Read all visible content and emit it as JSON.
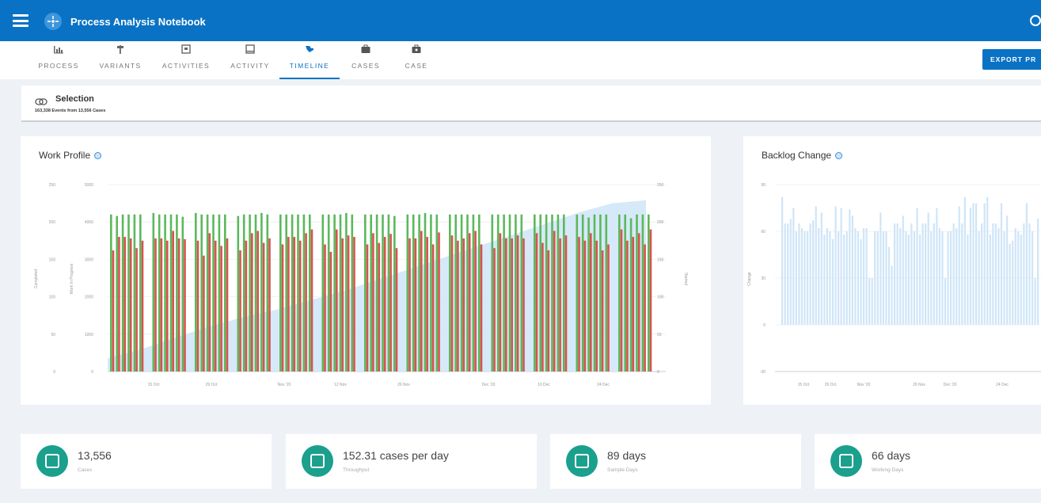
{
  "app": {
    "title": "Process Analysis Notebook"
  },
  "tabs": [
    {
      "label": "PROCESS",
      "icon": "bar-chart-icon"
    },
    {
      "label": "VARIANTS",
      "icon": "signpost-icon"
    },
    {
      "label": "ACTIVITIES",
      "icon": "activities-icon"
    },
    {
      "label": "ACTIVITY",
      "icon": "inbox-icon"
    },
    {
      "label": "TIMELINE",
      "icon": "timeline-icon",
      "active": true
    },
    {
      "label": "CASES",
      "icon": "briefcase-icon"
    },
    {
      "label": "CASE",
      "icon": "case-icon"
    }
  ],
  "toolbar": {
    "export_label": "EXPORT PR"
  },
  "selection": {
    "title": "Selection",
    "summary": "163,338 Events from 13,556 Cases",
    "icon": "link-icon"
  },
  "work_profile": {
    "title": "Work Profile"
  },
  "backlog_change": {
    "title": "Backlog Change"
  },
  "chart_data": [
    {
      "type": "bar",
      "title": "Work Profile",
      "left_axis": {
        "label": "Completed",
        "ticks": [
          "0",
          "50",
          "100",
          "150",
          "200",
          "250"
        ]
      },
      "middle_axis": {
        "label": "Work In Progress",
        "ticks": [
          "0",
          "1000",
          "2000",
          "3000",
          "4000",
          "5000"
        ]
      },
      "right_axis": {
        "label": "Started",
        "ticks": [
          "0",
          "50",
          "100",
          "150",
          "200",
          "250"
        ]
      },
      "x_labels": [
        "15 Oct",
        "29 Oct",
        "Nov '20",
        "12 Nov",
        "26 Nov",
        "Dec '20",
        "10 Dec",
        "24 Dec"
      ],
      "weeks": 13,
      "series": [
        {
          "name": "Started",
          "color": "#5cb85c",
          "values": [
            210,
            208,
            210,
            210,
            210,
            210,
            212,
            210,
            210,
            210,
            210,
            207,
            212,
            210,
            210,
            210,
            210,
            210,
            208,
            210,
            210,
            210,
            212,
            210,
            210,
            210,
            210,
            210,
            210,
            210,
            210,
            210,
            210,
            210,
            212,
            210,
            210,
            210,
            210,
            210,
            210,
            208,
            210,
            210,
            210,
            212,
            210,
            210,
            210,
            210,
            210,
            210,
            210,
            210,
            210,
            210,
            210,
            210,
            210,
            210,
            210,
            210,
            210,
            210,
            210,
            210,
            210,
            210,
            206,
            210,
            210,
            210,
            210,
            210,
            205,
            210,
            210,
            210,
            211,
            210
          ]
        },
        {
          "name": "Completed",
          "color": "#d9534f",
          "values": [
            162,
            180,
            180,
            178,
            165,
            175,
            178,
            178,
            175,
            188,
            178,
            177,
            175,
            155,
            185,
            175,
            168,
            178,
            162,
            175,
            185,
            188,
            172,
            178,
            170,
            180,
            180,
            175,
            185,
            190,
            170,
            160,
            190,
            178,
            182,
            180,
            170,
            185,
            172,
            180,
            184,
            165,
            178,
            178,
            188,
            180,
            170,
            186,
            182,
            175,
            178,
            185,
            188,
            170,
            165,
            185,
            178,
            178,
            182,
            178,
            185,
            172,
            162,
            188,
            178,
            182,
            180,
            175,
            185,
            175,
            162,
            170,
            190,
            175,
            180,
            185,
            170,
            190,
            135,
            165
          ]
        },
        {
          "name": "Work In Progress",
          "color": "#cfe5f8",
          "values": [
            350,
            600,
            900,
            1200,
            1450,
            1650,
            1900,
            2150,
            2450,
            2750,
            3050,
            3350,
            3650,
            3950,
            4250,
            4500,
            4580
          ]
        }
      ]
    },
    {
      "type": "bar",
      "title": "Backlog Change",
      "y_axis": {
        "label": "Change",
        "ticks": [
          "-30",
          "0",
          "30",
          "60",
          "90"
        ],
        "ylim": [
          -30,
          90
        ]
      },
      "x_labels": [
        "15 Oct",
        "29 Oct",
        "Nov '20",
        "26 Nov",
        "Dec '20",
        "24 Dec"
      ],
      "series": [
        {
          "name": "Change",
          "color": "#cfe5f8",
          "values": [
            82,
            65,
            65,
            68,
            75,
            60,
            65,
            62,
            60,
            60,
            65,
            67,
            76,
            62,
            72,
            58,
            62,
            60,
            55,
            76,
            60,
            75,
            58,
            60,
            74,
            70,
            62,
            60,
            55,
            62,
            62,
            30,
            30,
            60,
            60,
            72,
            60,
            60,
            50,
            38,
            65,
            65,
            62,
            70,
            60,
            58,
            65,
            60,
            75,
            58,
            65,
            65,
            72,
            60,
            65,
            75,
            62,
            60,
            30,
            60,
            60,
            65,
            62,
            76,
            65,
            82,
            58,
            75,
            78,
            78,
            60,
            65,
            78,
            82,
            58,
            65,
            65,
            62,
            78,
            60,
            70,
            52,
            54,
            62,
            60,
            58,
            65,
            78,
            65,
            60,
            30,
            68,
            80,
            70
          ]
        }
      ]
    }
  ],
  "stats": [
    {
      "value": "13,556",
      "label": "Cases",
      "icon": "briefcase-icon"
    },
    {
      "value": "152.31 cases per day",
      "label": "Throughput",
      "icon": "throughput-icon"
    },
    {
      "value": "89 days",
      "label": "Sample Days",
      "icon": "calendar-icon"
    },
    {
      "value": "66 days",
      "label": "Working Days",
      "icon": "workdays-icon"
    }
  ]
}
